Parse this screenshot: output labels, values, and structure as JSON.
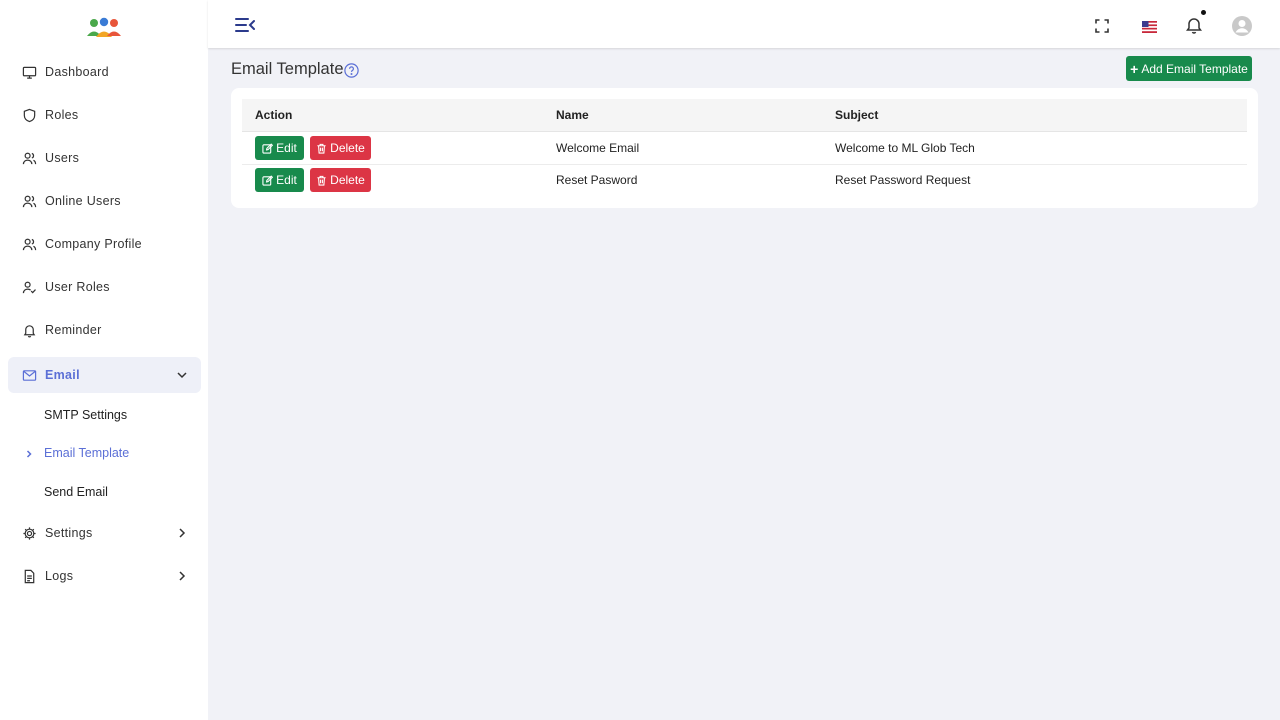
{
  "sidebar": {
    "items": [
      {
        "label": "Dashboard",
        "icon": "monitor-icon"
      },
      {
        "label": "Roles",
        "icon": "shield-icon"
      },
      {
        "label": "Users",
        "icon": "users-icon"
      },
      {
        "label": "Online Users",
        "icon": "users-icon"
      },
      {
        "label": "Company Profile",
        "icon": "users-icon"
      },
      {
        "label": "User Roles",
        "icon": "user-check-icon"
      },
      {
        "label": "Reminder",
        "icon": "bell-icon"
      },
      {
        "label": "Email",
        "icon": "mail-icon"
      },
      {
        "label": "Settings",
        "icon": "gear-icon"
      },
      {
        "label": "Logs",
        "icon": "file-icon"
      }
    ],
    "email_sub": [
      {
        "label": "SMTP Settings"
      },
      {
        "label": "Email Template"
      },
      {
        "label": "Send Email"
      }
    ]
  },
  "main": {
    "title": "Email Template",
    "add_button": "Add Email Template",
    "table": {
      "columns": [
        "Action",
        "Name",
        "Subject"
      ],
      "rows": [
        {
          "name": "Welcome Email",
          "subject": "Welcome to ML Glob Tech"
        },
        {
          "name": "Reset Pasword",
          "subject": "Reset Password Request"
        }
      ],
      "edit_label": "Edit",
      "delete_label": "Delete"
    }
  },
  "colors": {
    "accent": "#5b6fd6",
    "success": "#188a4c",
    "danger": "#dc3545",
    "background": "#f1f2f7"
  }
}
